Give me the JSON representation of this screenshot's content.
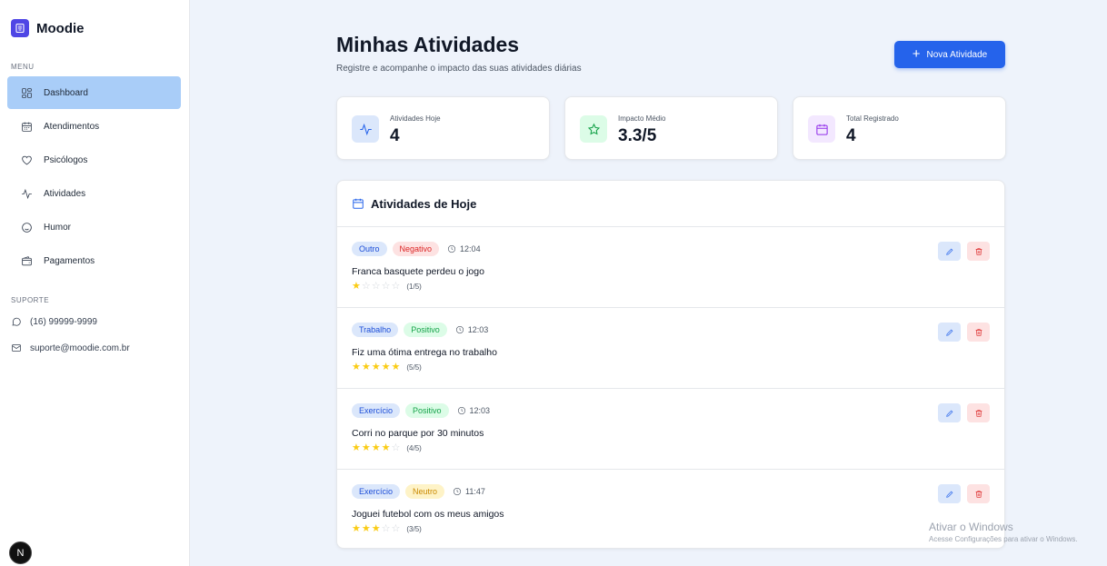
{
  "sidebar": {
    "brand": "Moodie",
    "menu_label": "MENU",
    "items": [
      {
        "label": "Dashboard",
        "icon": "dashboard-icon",
        "active": true
      },
      {
        "label": "Atendimentos",
        "icon": "calendar-icon",
        "active": false
      },
      {
        "label": "Psicólogos",
        "icon": "heart-icon",
        "active": false
      },
      {
        "label": "Atividades",
        "icon": "activity-icon",
        "active": false
      },
      {
        "label": "Humor",
        "icon": "smile-icon",
        "active": false
      },
      {
        "label": "Pagamentos",
        "icon": "wallet-icon",
        "active": false
      }
    ],
    "support_label": "SUPORTE",
    "phone": "(16) 99999-9999",
    "email": "suporte@moodie.com.br",
    "badge": "N"
  },
  "header": {
    "title": "Minhas Atividades",
    "subtitle": "Registre e acompanhe o impacto das suas atividades diárias",
    "new_button": "Nova Atividade"
  },
  "stats": [
    {
      "label": "Atividades Hoje",
      "value": "4",
      "icon": "activity-icon",
      "color": "#2563eb",
      "bg": "#dbe7fb"
    },
    {
      "label": "Impacto Médio",
      "value": "3.3/5",
      "icon": "star-icon",
      "color": "#16a34a",
      "bg": "#dcfce7"
    },
    {
      "label": "Total Registrado",
      "value": "4",
      "icon": "calendar-icon",
      "color": "#9333ea",
      "bg": "#f3e8ff"
    }
  ],
  "panel": {
    "title": "Atividades de Hoje",
    "activities": [
      {
        "category": "Outro",
        "sentiment": "Negativo",
        "time": "12:04",
        "description": "Franca basquete perdeu o jogo",
        "rating": 1,
        "rating_text": "(1/5)"
      },
      {
        "category": "Trabalho",
        "sentiment": "Positivo",
        "time": "12:03",
        "description": "Fiz uma ótima entrega no trabalho",
        "rating": 5,
        "rating_text": "(5/5)"
      },
      {
        "category": "Exercício",
        "sentiment": "Positivo",
        "time": "12:03",
        "description": "Corri no parque por 30 minutos",
        "rating": 4,
        "rating_text": "(4/5)"
      },
      {
        "category": "Exercício",
        "sentiment": "Neutro",
        "time": "11:47",
        "description": "Joguei futebol com os meus amigos",
        "rating": 3,
        "rating_text": "(3/5)"
      }
    ]
  },
  "watermark": {
    "line1": "Ativar o Windows",
    "line2": "Acesse Configurações para ativar o Windows."
  }
}
